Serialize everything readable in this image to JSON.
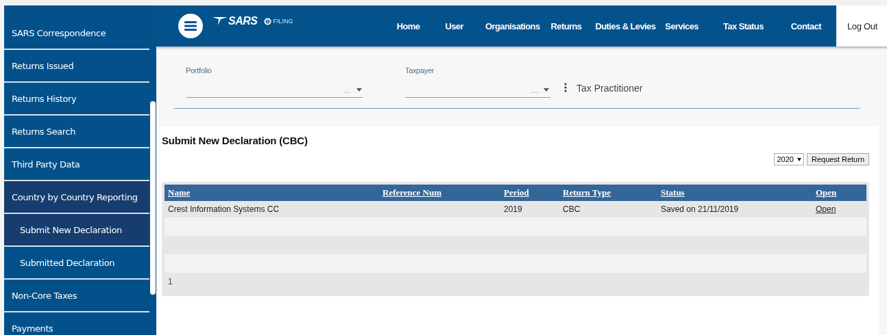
{
  "sidebar": {
    "items": [
      {
        "label": "SARS Correspondence",
        "selected": false,
        "expanded": false
      },
      {
        "label": "Returns Issued",
        "selected": false,
        "expanded": false
      },
      {
        "label": "Returns History",
        "selected": false,
        "expanded": false
      },
      {
        "label": "Returns Search",
        "selected": false,
        "expanded": false
      },
      {
        "label": "Third Party Data",
        "selected": false,
        "expanded": false
      },
      {
        "label": "Country by Country Reporting",
        "selected": false,
        "expanded": true,
        "children": [
          {
            "label": "Submit New Declaration",
            "selected": true
          },
          {
            "label": "Submitted Declaration",
            "selected": false
          }
        ]
      },
      {
        "label": "Non-Core Taxes",
        "selected": false,
        "expanded": false
      },
      {
        "label": "Payments",
        "selected": false,
        "expanded": false
      }
    ]
  },
  "header": {
    "logo": "SARS",
    "product": "FILING",
    "nav": [
      "Home",
      "User",
      "Organisations",
      "Returns",
      "Duties & Levies",
      "Services",
      "Tax Status",
      "Contact"
    ],
    "logout": "Log Out"
  },
  "filters": {
    "portfolio": {
      "label": "Portfolio",
      "value": "..."
    },
    "taxpayer": {
      "label": "Taxpayer",
      "value": "..."
    },
    "role": "Tax Practitioner"
  },
  "page": {
    "title": "Submit New Declaration (CBC)",
    "year": "2020",
    "request_button": "Request Return"
  },
  "table": {
    "columns": [
      "Name",
      "Reference Num",
      "Period",
      "Return Type",
      "Status",
      "Open"
    ],
    "rows": [
      {
        "name": "Crest Information Systems CC",
        "period": "2019",
        "return_type": "CBC",
        "status": "Saved on 21/11/2019",
        "open": "Open"
      }
    ],
    "pager": "1"
  }
}
